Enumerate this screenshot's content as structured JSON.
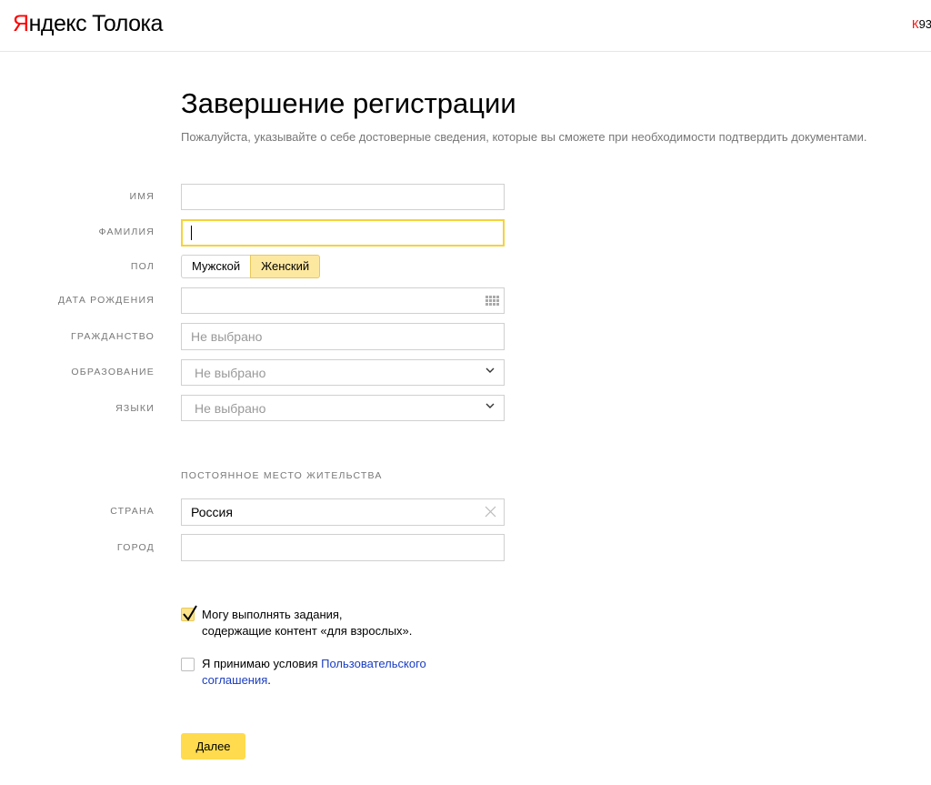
{
  "header": {
    "logo_brand_first": "Я",
    "logo_brand_rest": "ндекс",
    "logo_product": "Толока",
    "user_login_first": "К",
    "user_login_rest": "93"
  },
  "page": {
    "title": "Завершение регистрации",
    "subtitle": "Пожалуйста, указывайте о себе достоверные сведения, которые вы сможете при необходимости подтвердить документами."
  },
  "form": {
    "first_name": {
      "label": "ИМЯ",
      "value": ""
    },
    "last_name": {
      "label": "ФАМИЛИЯ",
      "value": "",
      "focused": true
    },
    "gender": {
      "label": "ПОЛ",
      "options": [
        "Мужской",
        "Женский"
      ],
      "selected": "Женский"
    },
    "birth_date": {
      "label": "ДАТА РОЖДЕНИЯ",
      "value": "",
      "icon": "calendar-icon"
    },
    "citizenship": {
      "label": "ГРАЖДАНСТВО",
      "placeholder": "Не выбрано"
    },
    "education": {
      "label": "ОБРАЗОВАНИЕ",
      "placeholder": "Не выбрано",
      "icon": "chevron-down-icon"
    },
    "languages": {
      "label": "ЯЗЫКИ",
      "placeholder": "Не выбрано",
      "icon": "chevron-down-icon"
    }
  },
  "residence": {
    "section_title": "ПОСТОЯННОЕ МЕСТО ЖИТЕЛЬСТВА",
    "country": {
      "label": "СТРАНА",
      "value": "Россия",
      "icon": "clear-icon"
    },
    "city": {
      "label": "ГОРОД",
      "value": ""
    }
  },
  "checkboxes": {
    "adult_content": {
      "line1": "Могу выполнять задания,",
      "line2": "содержащие контент «для взрослых».",
      "checked": true
    },
    "agreement": {
      "text_before": "Я принимаю условия ",
      "link_part1": "Пользовательского",
      "link_part2": "соглашения",
      "text_after": ".",
      "checked": false
    }
  },
  "actions": {
    "next_label": "Далее"
  },
  "colors": {
    "accent_yellow": "#ffdb4d",
    "focus_border": "#f5d23b",
    "selected_toggle": "#fde8a0",
    "link": "#1a3dc1",
    "brand_red": "#ff0000",
    "label_gray": "#777777"
  }
}
